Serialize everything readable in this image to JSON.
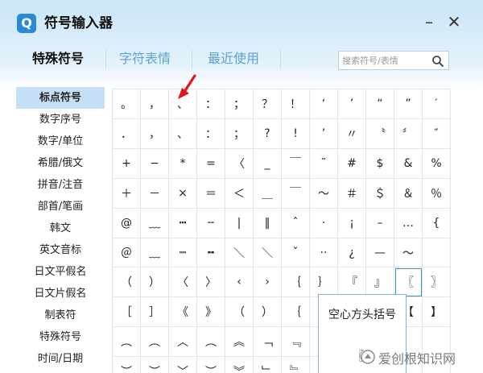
{
  "title": "符号输入器",
  "app_icon_letter": "Q",
  "window_buttons": {
    "minimize": "–",
    "close": "✕"
  },
  "tabs": [
    "特殊符号",
    "字符表情",
    "最近使用"
  ],
  "search": {
    "placeholder": "搜索符号/表情"
  },
  "sidebar": [
    "标点符号",
    "数字序号",
    "数字/单位",
    "希腊/俄文",
    "拼音/注音",
    "部首/笔画",
    "韩文",
    "英文音标",
    "日文平假名",
    "日文片假名",
    "制表符",
    "特殊符号",
    "时间/日期"
  ],
  "grid1": [
    [
      "。",
      "，",
      "、",
      "：",
      "；",
      "？",
      "！",
      "‘",
      "’",
      "“",
      "”",
      "′"
    ],
    [
      "．",
      "，",
      "、",
      "：",
      "；",
      "?",
      "!",
      "’",
      "〃",
      "〝",
      "〞",
      "″"
    ],
    [
      "+",
      "−",
      "*",
      "=",
      "〈",
      "_",
      "￣",
      "˜",
      "#",
      "$",
      "&",
      "%"
    ],
    [
      "＋",
      "－",
      "×",
      "＝",
      "＜",
      "＿",
      "￣",
      "～",
      "＃",
      "＄",
      "＆",
      "％"
    ],
    [
      "@",
      "﹏",
      "┅",
      "╌",
      "|",
      "‖",
      "ˆ",
      "·",
      "¡",
      "–",
      "…",
      "{"
    ],
    [
      "＠",
      "﹏",
      "┉",
      "╍",
      "＼",
      "＼",
      "ˇ",
      "··",
      "¿",
      "—",
      "～",
      ""
    ]
  ],
  "grid2": [
    [
      "（",
      "）",
      "〈",
      "〉",
      "‹",
      "›",
      "｛",
      "｝",
      "『",
      "』",
      "〖",
      "〗"
    ],
    [
      "［",
      "］",
      "《",
      "》",
      "（",
      "）",
      "｛",
      "",
      "",
      "",
      "【",
      "】"
    ],
    [
      "︵",
      "︵",
      "︿",
      "︵",
      "︽",
      "﹁",
      "﹃",
      "",
      "",
      "",
      "",
      ""
    ],
    [
      "︶",
      "︶",
      "﹀",
      "︶",
      "︾",
      "﹂",
      "﹄",
      "",
      "",
      "",
      "",
      ""
    ]
  ],
  "tooltip": {
    "title": "空心方头括号",
    "glyph": "〖"
  },
  "watermark": "爱创根知识网",
  "colors": {
    "accent": "#2a8ad8",
    "selected_category_bg": "#c5e0f6",
    "arrow": "#e0161b",
    "tab_inactive": "#5aa2d6"
  }
}
